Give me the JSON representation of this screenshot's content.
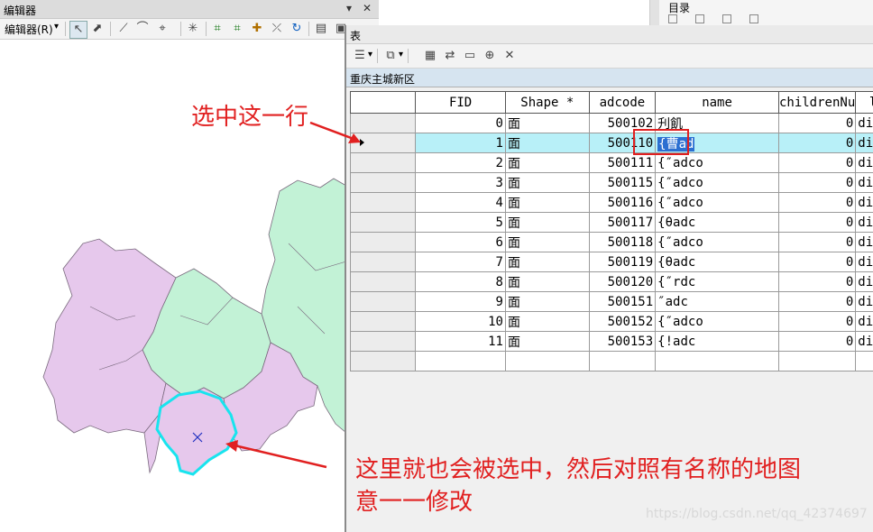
{
  "editor": {
    "title": "编辑器",
    "menu_label": "编辑器(R)",
    "pin": "▾",
    "close": "✕"
  },
  "toc": {
    "title": "目录"
  },
  "table_window": {
    "title": "表",
    "layer_tab": "重庆主城新区"
  },
  "table": {
    "columns": [
      "FID",
      "Shape *",
      "adcode",
      "name",
      "childrenNu",
      "l"
    ],
    "rows": [
      {
        "fid": "0",
        "shape": "面",
        "adcode": "500102",
        "name": "刋飢",
        "children": "0",
        "level": "dist"
      },
      {
        "fid": "1",
        "shape": "面",
        "adcode": "500110",
        "name": "{曹ad",
        "children": "0",
        "level": "dist"
      },
      {
        "fid": "2",
        "shape": "面",
        "adcode": "500111",
        "name": "{″adco",
        "children": "0",
        "level": "dist"
      },
      {
        "fid": "3",
        "shape": "面",
        "adcode": "500115",
        "name": "{″adco",
        "children": "0",
        "level": "dist"
      },
      {
        "fid": "4",
        "shape": "面",
        "adcode": "500116",
        "name": "{″adco",
        "children": "0",
        "level": "dist"
      },
      {
        "fid": "5",
        "shape": "面",
        "adcode": "500117",
        "name": "{θadc",
        "children": "0",
        "level": "dist"
      },
      {
        "fid": "6",
        "shape": "面",
        "adcode": "500118",
        "name": "{″adco",
        "children": "0",
        "level": "dist"
      },
      {
        "fid": "7",
        "shape": "面",
        "adcode": "500119",
        "name": "{θadc",
        "children": "0",
        "level": "dist"
      },
      {
        "fid": "8",
        "shape": "面",
        "adcode": "500120",
        "name": "{″rdc",
        "children": "0",
        "level": "dist"
      },
      {
        "fid": "9",
        "shape": "面",
        "adcode": "500151",
        "name": "″adc",
        "children": "0",
        "level": "dist"
      },
      {
        "fid": "10",
        "shape": "面",
        "adcode": "500152",
        "name": "{″adco",
        "children": "0",
        "level": "dist"
      },
      {
        "fid": "11",
        "shape": "面",
        "adcode": "500153",
        "name": "{!adc",
        "children": "0",
        "level": "dist"
      }
    ],
    "selected_row": 1
  },
  "annotations": {
    "select_row": "选中这一行",
    "note_line1": "这里就也会被选中，然后对照有名称的地图",
    "note_line2": "意一一修改"
  },
  "watermark": "https://blog.csdn.net/qq_42374697",
  "colors": {
    "region_pink": "#e6c8ec",
    "region_green": "#c2f2d6",
    "region_outline": "#7a6a7e",
    "selected_outline": "#18e4ee",
    "selected_row": "#b8f0f8",
    "annotation_red": "#e12020"
  }
}
